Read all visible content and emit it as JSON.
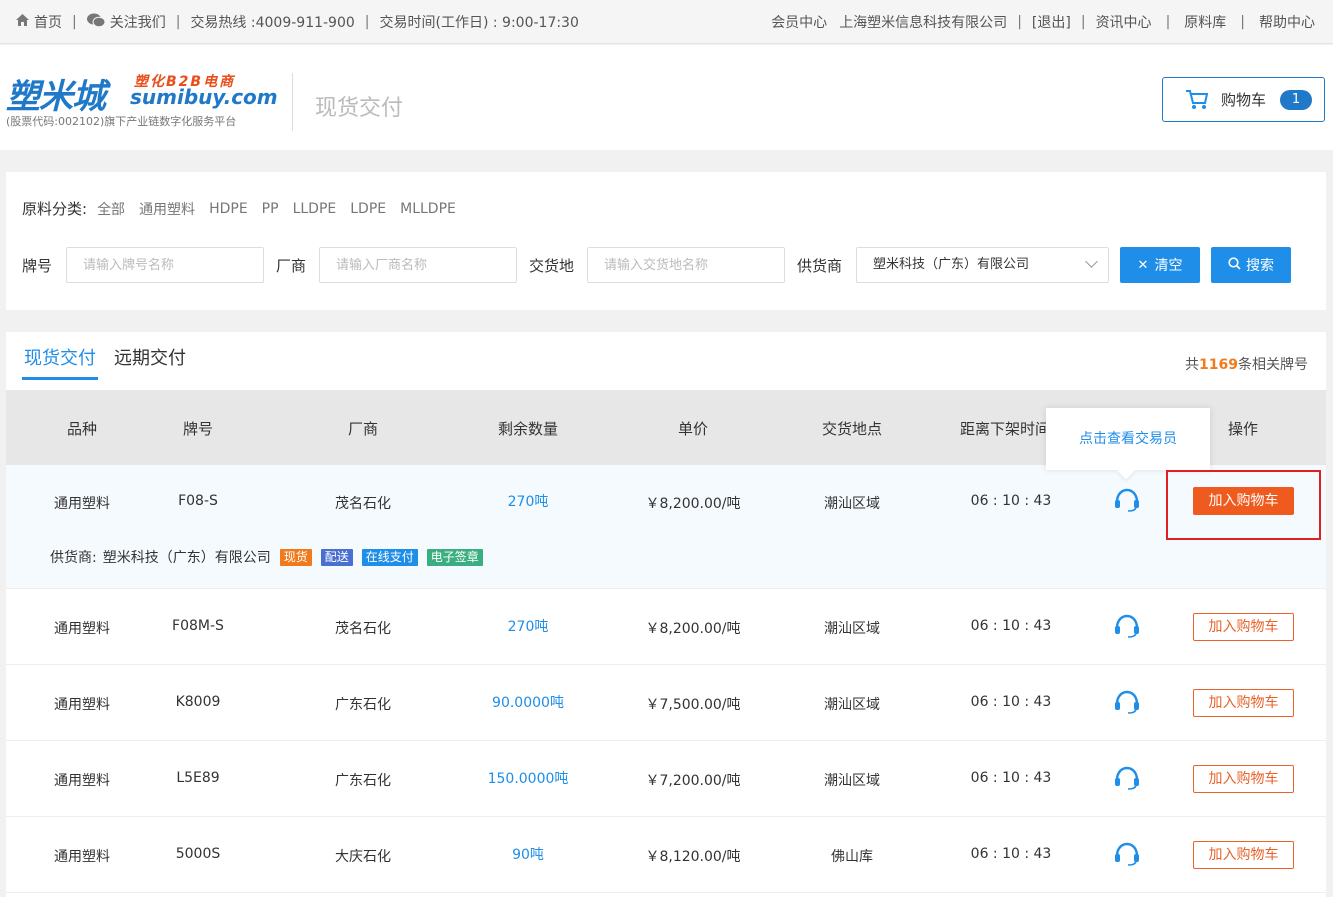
{
  "topbar": {
    "home": "首页",
    "follow": "关注我们",
    "hotline": "交易热线 :4009-911-900",
    "hours": "交易时间(工作日) : 9:00-17:30",
    "member": "会员中心",
    "company": "上海塑米信息科技有限公司",
    "logout": "[退出]",
    "news": "资讯中心",
    "materials": "原料库",
    "help": "帮助中心"
  },
  "header": {
    "logo_main": "塑米城",
    "logo_tag": "塑化B2B电商",
    "logo_domain": "sumibuy.com",
    "logo_desc": "(股票代码:002102)旗下产业链数字化服务平台",
    "subtitle": "现货交付",
    "cart_label": "购物车",
    "cart_count": "1"
  },
  "filter": {
    "category_label": "原料分类:",
    "categories": [
      "全部",
      "通用塑料",
      "HDPE",
      "PP",
      "LLDPE",
      "LDPE",
      "MLLDPE"
    ],
    "brand_label": "牌号",
    "brand_placeholder": "请输入牌号名称",
    "maker_label": "厂商",
    "maker_placeholder": "请输入厂商名称",
    "place_label": "交货地",
    "place_placeholder": "请输入交货地名称",
    "supplier_label": "供货商",
    "supplier_value": "塑米科技（广东）有限公司",
    "clear_label": "清空",
    "search_label": "搜索"
  },
  "list": {
    "tabs": [
      "现货交付",
      "远期交付"
    ],
    "total_prefix": "共",
    "total_count": "1169",
    "total_suffix": "条相关牌号",
    "headers": [
      "品种",
      "牌号",
      "厂商",
      "剩余数量",
      "单价",
      "交货地点",
      "距离下架时间",
      "操作"
    ],
    "tooltip": "点击查看交易员",
    "add_label": "加入购物车",
    "supplier_prefix": "供货商:",
    "supplier_name": "塑米科技（广东）有限公司",
    "tags": [
      {
        "text": "现货",
        "color": "#f07a1c"
      },
      {
        "text": "配送",
        "color": "#4a6fd0"
      },
      {
        "text": "在线支付",
        "color": "#1f8ee8"
      },
      {
        "text": "电子签章",
        "color": "#3aae7f"
      }
    ],
    "rows": [
      {
        "variety": "通用塑料",
        "brand": "F08-S",
        "maker": "茂名石化",
        "qty": "270吨",
        "price": "￥8,200.00/吨",
        "place": "潮汕区域",
        "countdown": "06 : 10 : 43"
      },
      {
        "variety": "通用塑料",
        "brand": "F08M-S",
        "maker": "茂名石化",
        "qty": "270吨",
        "price": "￥8,200.00/吨",
        "place": "潮汕区域",
        "countdown": "06 : 10 : 43"
      },
      {
        "variety": "通用塑料",
        "brand": "K8009",
        "maker": "广东石化",
        "qty": "90.0000吨",
        "price": "￥7,500.00/吨",
        "place": "潮汕区域",
        "countdown": "06 : 10 : 43"
      },
      {
        "variety": "通用塑料",
        "brand": "L5E89",
        "maker": "广东石化",
        "qty": "150.0000吨",
        "price": "￥7,200.00/吨",
        "place": "潮汕区域",
        "countdown": "06 : 10 : 43"
      },
      {
        "variety": "通用塑料",
        "brand": "5000S",
        "maker": "大庆石化",
        "qty": "90吨",
        "price": "￥8,120.00/吨",
        "place": "佛山库",
        "countdown": "06 : 10 : 43"
      }
    ]
  }
}
